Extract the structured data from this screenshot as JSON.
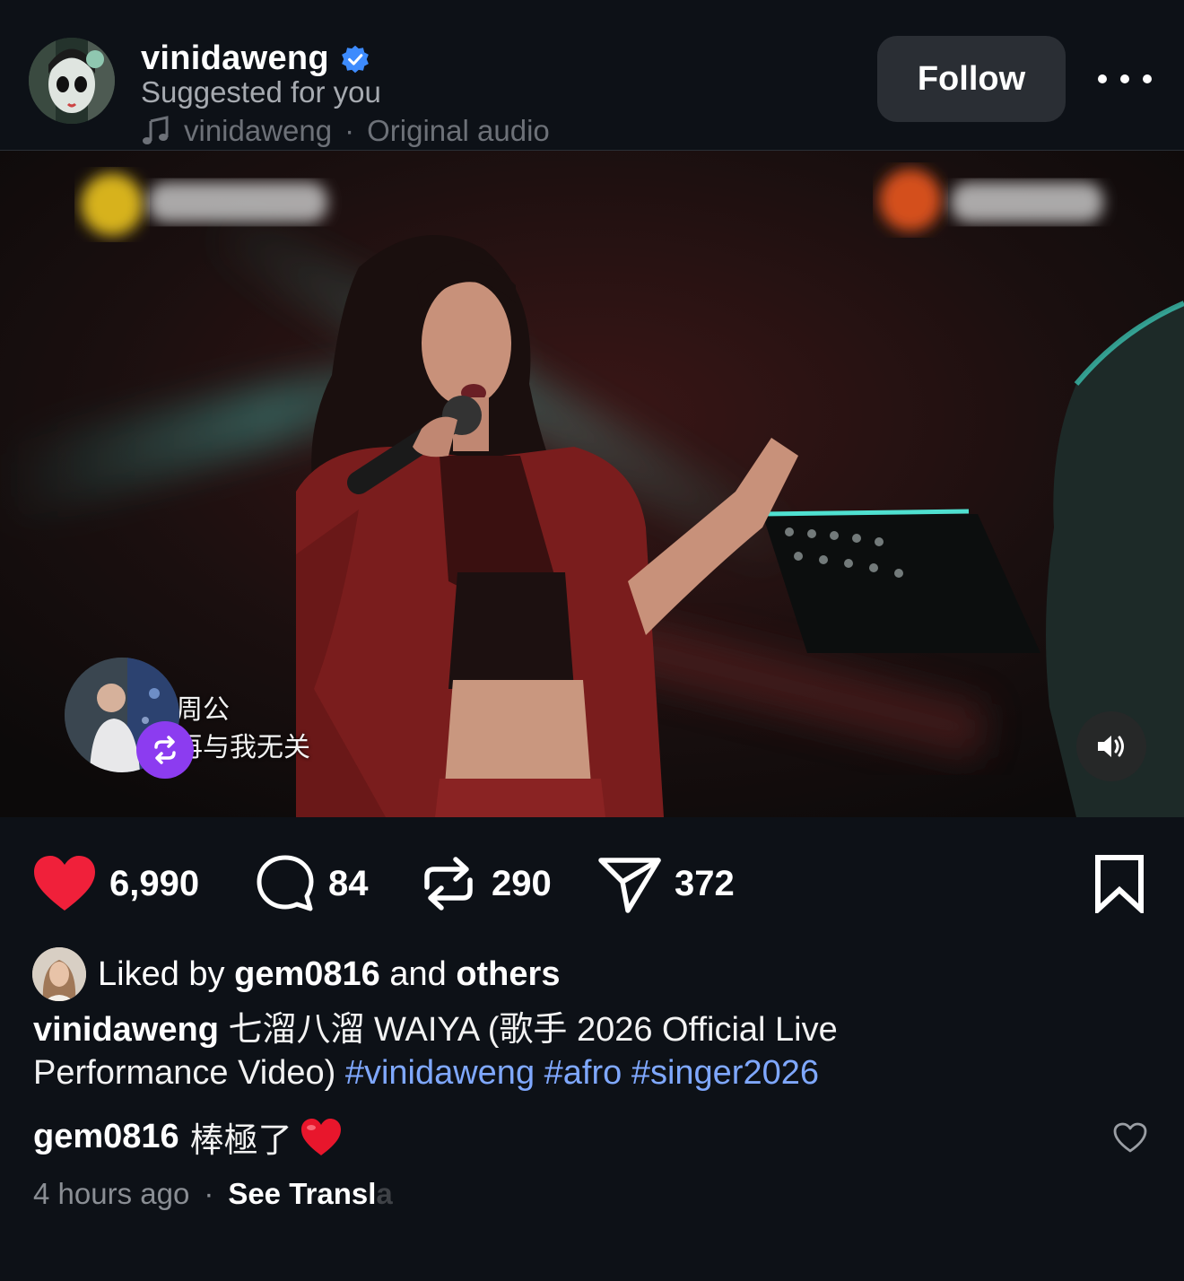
{
  "header": {
    "username": "vinidaweng",
    "verified": true,
    "suggested": "Suggested for you",
    "audio_user": "vinidaweng",
    "audio_separator": "·",
    "audio_label": "Original audio",
    "follow_label": "Follow"
  },
  "video": {
    "lyrics": [
      "周公",
      "再与我无关"
    ],
    "icons": [
      "remix-icon",
      "volume-icon"
    ]
  },
  "actions": {
    "likes": "6,990",
    "comments": "84",
    "reposts": "290",
    "shares": "372"
  },
  "liked_by": {
    "prefix": "Liked by",
    "user": "gem0816",
    "middle": "and",
    "suffix": "others"
  },
  "caption": {
    "user": "vinidaweng",
    "text": "七溜八溜 WAIYA (歌手 2026 Official Live Performance Video)",
    "hashtags": [
      "#vinidaweng",
      "#afro",
      "#singer2026"
    ]
  },
  "comment": {
    "user": "gem0816",
    "text": "棒極了"
  },
  "meta": {
    "time": "4 hours ago",
    "dot": "·",
    "see_translation": "See Transl",
    "see_translation_faded": "a"
  },
  "colors": {
    "background": "#0d1117",
    "like": "#f0203a",
    "hashtag": "#7fa8ff",
    "verified": "#3d8bfd",
    "remix_badge": "#8c3cf0"
  }
}
